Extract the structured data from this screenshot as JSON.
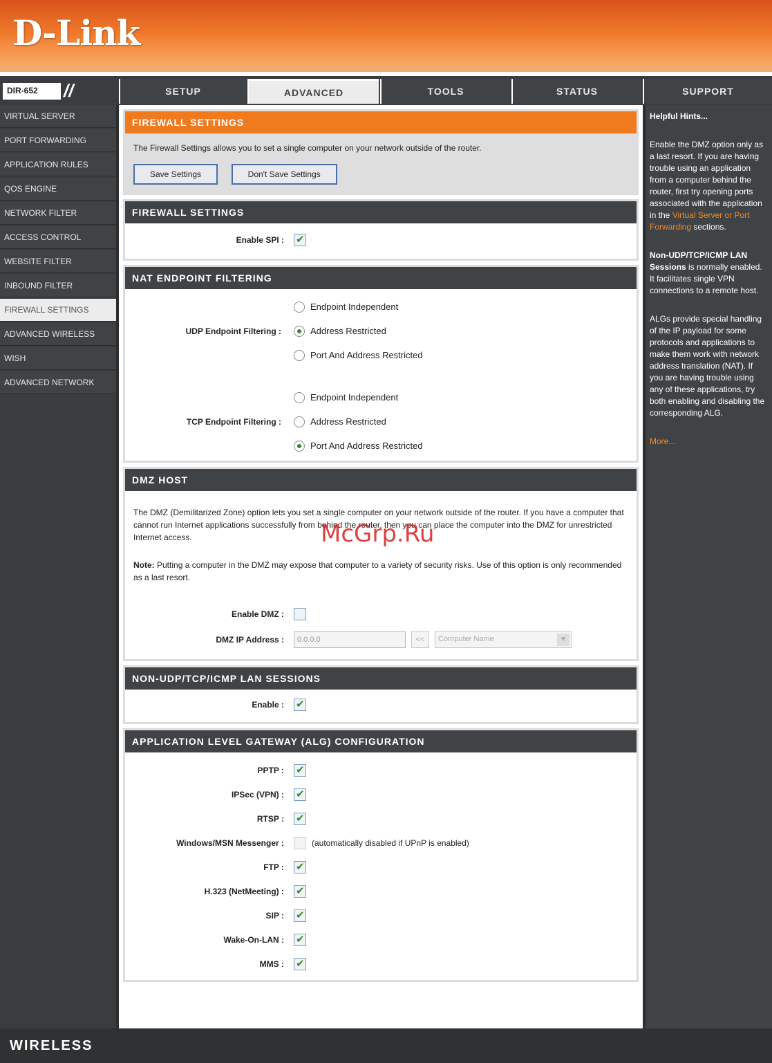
{
  "brand": {
    "logo": "D-Link",
    "model": "DIR-652",
    "footer": "WIRELESS"
  },
  "watermark": "McGrp.Ru",
  "tabs": [
    "SETUP",
    "ADVANCED",
    "TOOLS",
    "STATUS",
    "SUPPORT"
  ],
  "active_tab": "ADVANCED",
  "menu": [
    "VIRTUAL SERVER",
    "PORT FORWARDING",
    "APPLICATION RULES",
    "QOS ENGINE",
    "NETWORK FILTER",
    "ACCESS CONTROL",
    "WEBSITE FILTER",
    "INBOUND FILTER",
    "FIREWALL SETTINGS",
    "ADVANCED WIRELESS",
    "WISH",
    "ADVANCED NETWORK"
  ],
  "active_menu": "FIREWALL SETTINGS",
  "intro": {
    "title": "FIREWALL SETTINGS",
    "text": "The Firewall Settings allows you to set a single computer on your network outside of the router.",
    "save_label": "Save Settings",
    "dont_save_label": "Don't Save Settings"
  },
  "firewall": {
    "title": "FIREWALL SETTINGS",
    "spi_label": "Enable SPI :",
    "spi_checked": true
  },
  "nat": {
    "title": "NAT ENDPOINT FILTERING",
    "udp_label": "UDP Endpoint Filtering :",
    "tcp_label": "TCP Endpoint Filtering :",
    "options": [
      "Endpoint Independent",
      "Address Restricted",
      "Port And Address Restricted"
    ],
    "udp_selected": "Address Restricted",
    "tcp_selected": "Port And Address Restricted"
  },
  "dmz": {
    "title": "DMZ HOST",
    "text": "The DMZ (Demilitarized Zone) option lets you set a single computer on your network outside of the router. If you have a computer that cannot run Internet applications successfully from behind the router, then you can place the computer into the DMZ for unrestricted Internet access.",
    "note_label": "Note:",
    "note_text": " Putting a computer in the DMZ may expose that computer to a variety of security risks. Use of this option is only recommended as a last resort.",
    "enable_label": "Enable DMZ :",
    "enable_checked": false,
    "ip_label": "DMZ IP Address :",
    "ip_value": "0.0.0.0",
    "copy_button": "<<",
    "computer_name_placeholder": "Computer Name"
  },
  "lan_sessions": {
    "title": "NON-UDP/TCP/ICMP LAN SESSIONS",
    "enable_label": "Enable :",
    "enable_checked": true
  },
  "alg": {
    "title": "APPLICATION LEVEL GATEWAY (ALG) CONFIGURATION",
    "items": [
      {
        "label": "PPTP :",
        "checked": true,
        "note": ""
      },
      {
        "label": "IPSec (VPN) :",
        "checked": true,
        "note": ""
      },
      {
        "label": "RTSP :",
        "checked": true,
        "note": ""
      },
      {
        "label": "Windows/MSN Messenger :",
        "checked": false,
        "note": "(automatically disabled if UPnP is enabled)"
      },
      {
        "label": "FTP :",
        "checked": true,
        "note": ""
      },
      {
        "label": "H.323 (NetMeeting) :",
        "checked": true,
        "note": ""
      },
      {
        "label": "SIP :",
        "checked": true,
        "note": ""
      },
      {
        "label": "Wake-On-LAN :",
        "checked": true,
        "note": ""
      },
      {
        "label": "MMS :",
        "checked": true,
        "note": ""
      }
    ]
  },
  "hints": {
    "title": "Helpful Hints...",
    "p1_pre": "Enable the DMZ option only as a last resort. If you are having trouble using an application from a computer behind the router, first try opening ports associated with the application in the ",
    "p1_link": "Virtual Server or Port Forwarding",
    "p1_post": " sections.",
    "p2_bold": "Non-UDP/TCP/ICMP LAN Sessions",
    "p2_text": " is normally enabled. It facilitates single VPN connections to a remote host.",
    "p3": "ALGs provide special handling of the IP payload for some protocols and applications to make them work with network address translation (NAT). If you are having trouble using any of these applications, try both enabling and disabling the corresponding ALG.",
    "more": "More..."
  }
}
